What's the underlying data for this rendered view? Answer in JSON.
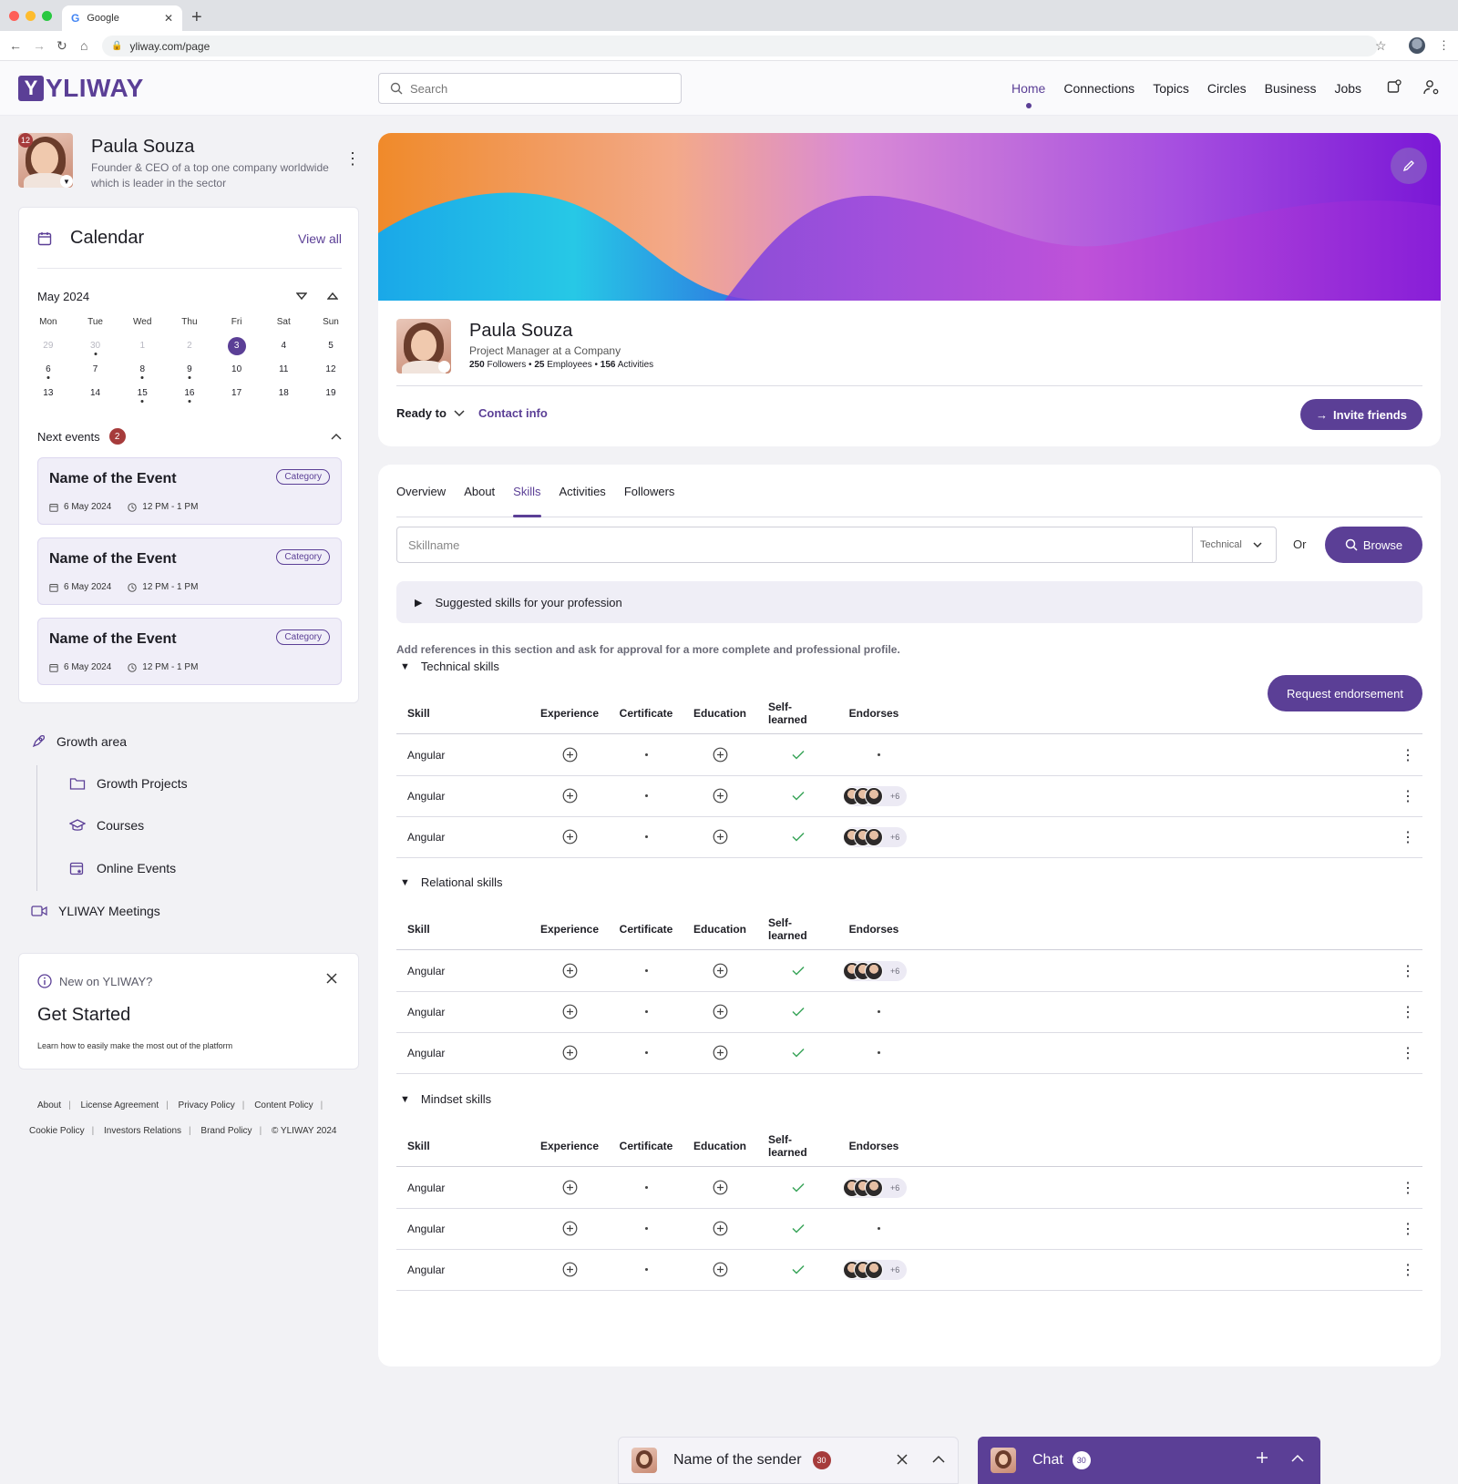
{
  "browser": {
    "tab_title": "Google",
    "url": "yliway.com/page"
  },
  "header": {
    "logo_text": "YLIWAY",
    "search_placeholder": "Search",
    "nav": [
      "Home",
      "Connections",
      "Topics",
      "Circles",
      "Business",
      "Jobs"
    ],
    "active_nav": "Home"
  },
  "user": {
    "notifications": "12",
    "name": "Paula Souza",
    "description": "Founder & CEO of a top one company worldwide which is leader in the sector"
  },
  "calendar": {
    "title": "Calendar",
    "view_all": "View all",
    "month": "May 2024",
    "weekdays": [
      "Mon",
      "Tue",
      "Wed",
      "Thu",
      "Fri",
      "Sat",
      "Sun"
    ],
    "weeks": [
      [
        "29",
        "30",
        "1",
        "2",
        "3",
        "4",
        "5"
      ],
      [
        "6",
        "7",
        "8",
        "9",
        "10",
        "11",
        "12"
      ],
      [
        "13",
        "14",
        "15",
        "16",
        "17",
        "18",
        "19"
      ]
    ],
    "today": "3",
    "next_events_label": "Next events",
    "next_events_count": "2",
    "events": [
      {
        "name": "Name of the Event",
        "category": "Category",
        "date": "6 May 2024",
        "time": "12 PM - 1 PM"
      },
      {
        "name": "Name of the Event",
        "category": "Category",
        "date": "6 May 2024",
        "time": "12 PM - 1 PM"
      },
      {
        "name": "Name of the Event",
        "category": "Category",
        "date": "6 May 2024",
        "time": "12 PM - 1 PM"
      }
    ]
  },
  "growth": {
    "title": "Growth area",
    "items": [
      "Growth Projects",
      "Courses",
      "Online Events"
    ],
    "meetings": "YLIWAY Meetings"
  },
  "get_started": {
    "new_label": "New on YLIWAY?",
    "title": "Get Started",
    "subtitle": "Learn how to easily make the most out of the platform"
  },
  "footer": {
    "row1": [
      "About",
      "License Agreement",
      "Privacy Policy",
      "Content Policy"
    ],
    "row2": [
      "Cookie Policy",
      "Investors Relations",
      "Brand Policy",
      "© YLIWAY 2024"
    ]
  },
  "profile": {
    "name": "Paula Souza",
    "title": "Project Manager at a Company",
    "followers": "250",
    "followers_label": "Followers",
    "employees": "25",
    "employees_label": "Employees",
    "activities": "156",
    "activities_label": "Activities",
    "ready_to": "Ready to",
    "contact_info": "Contact info",
    "invite": "Invite friends"
  },
  "skills": {
    "tabs": [
      "Overview",
      "About",
      "Skills",
      "Activities",
      "Followers"
    ],
    "active_tab": "Skills",
    "input_placeholder": "Skillname",
    "type_select": "Technical",
    "or": "Or",
    "browse": "Browse",
    "suggested": "Suggested skills for your profession",
    "note": "Add references in this section and ask for approval for a more complete and professional profile.",
    "request_endorsement": "Request endorsement",
    "columns": [
      "Skill",
      "Experience",
      "Certificate",
      "Education",
      "Self-learned",
      "Endorses"
    ],
    "sections": [
      {
        "title": "Technical skills",
        "rows": [
          {
            "skill": "Angular",
            "endorses": "",
            "more": ""
          },
          {
            "skill": "Angular",
            "endorses": "avatars",
            "more": "+6"
          },
          {
            "skill": "Angular",
            "endorses": "avatars",
            "more": "+6"
          }
        ]
      },
      {
        "title": "Relational skills",
        "rows": [
          {
            "skill": "Angular",
            "endorses": "avatars",
            "more": "+6"
          },
          {
            "skill": "Angular",
            "endorses": "",
            "more": ""
          },
          {
            "skill": "Angular",
            "endorses": "",
            "more": ""
          }
        ]
      },
      {
        "title": "Mindset skills",
        "rows": [
          {
            "skill": "Angular",
            "endorses": "avatars",
            "more": "+6"
          },
          {
            "skill": "Angular",
            "endorses": "",
            "more": ""
          },
          {
            "skill": "Angular",
            "endorses": "avatars",
            "more": "+6"
          }
        ]
      }
    ]
  },
  "chat": {
    "sender_name": "Name of the sender",
    "sender_count": "30",
    "chat_label": "Chat",
    "chat_count": "30"
  },
  "colors": {
    "brand": "#5b3f96",
    "badge": "#a63b3b",
    "check": "#3aa55a"
  }
}
